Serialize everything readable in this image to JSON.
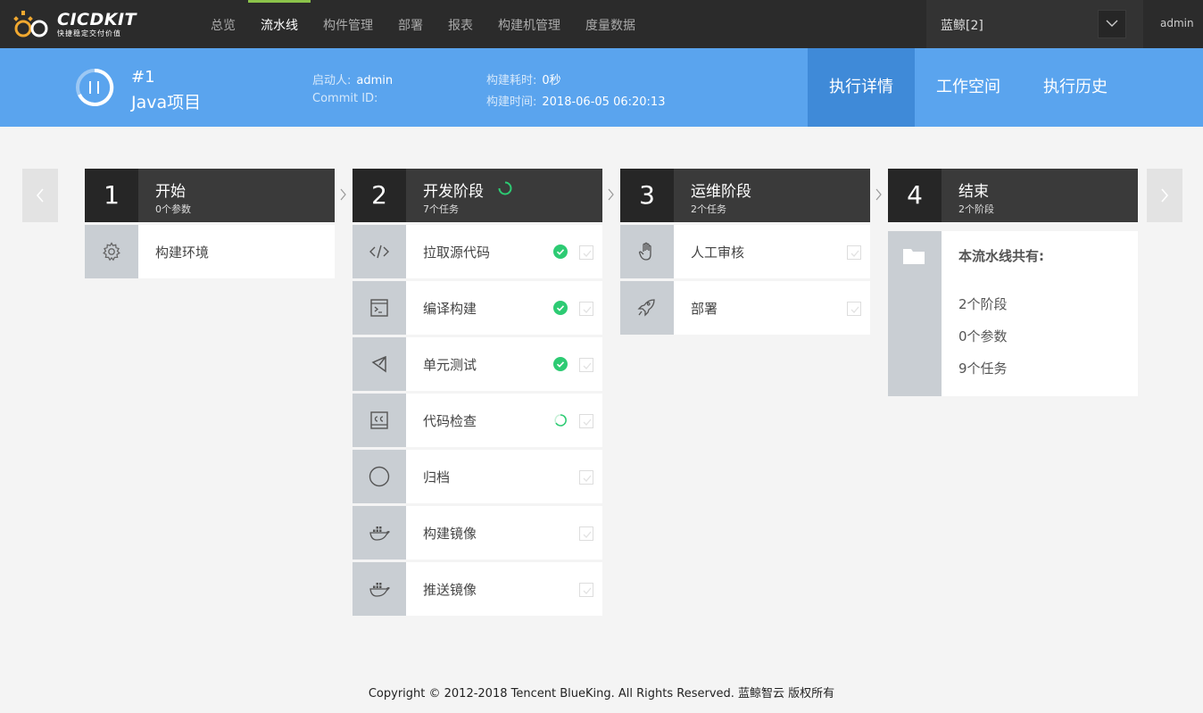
{
  "app": {
    "logo_text": "CICDKIT",
    "logo_sub": "快捷稳定交付价值"
  },
  "nav": {
    "items": [
      "总览",
      "流水线",
      "构件管理",
      "部署",
      "报表",
      "构建机管理",
      "度量数据"
    ],
    "active_index": 1
  },
  "business": {
    "label": "蓝鲸[2]"
  },
  "user": {
    "name": "admin"
  },
  "build": {
    "number": "#1",
    "name": "Java项目",
    "starter_label": "启动人:",
    "starter": "admin",
    "commit_label": "Commit ID:",
    "commit": "",
    "duration_label": "构建耗时:",
    "duration": "0秒",
    "time_label": "构建时间:",
    "time": "2018-06-05 06:20:13",
    "state": "paused"
  },
  "tabs": [
    "执行详情",
    "工作空间",
    "执行历史"
  ],
  "stages": [
    {
      "num": "1",
      "title": "开始",
      "sub": "0个参数",
      "running": false,
      "tasks": [
        {
          "name": "构建环境",
          "icon": "gear-icon",
          "status": "none"
        }
      ]
    },
    {
      "num": "2",
      "title": "开发阶段",
      "sub": "7个任务",
      "running": true,
      "tasks": [
        {
          "name": "拉取源代码",
          "icon": "code-icon",
          "status": "success"
        },
        {
          "name": "编译构建",
          "icon": "terminal-icon",
          "status": "success"
        },
        {
          "name": "单元测试",
          "icon": "unit-test-icon",
          "status": "success"
        },
        {
          "name": "代码检查",
          "icon": "code-check-icon",
          "status": "running"
        },
        {
          "name": "归档",
          "icon": "circle-icon",
          "status": "pending"
        },
        {
          "name": "构建镜像",
          "icon": "docker-icon",
          "status": "pending"
        },
        {
          "name": "推送镜像",
          "icon": "docker-icon",
          "status": "pending"
        }
      ]
    },
    {
      "num": "3",
      "title": "运维阶段",
      "sub": "2个任务",
      "running": false,
      "tasks": [
        {
          "name": "人工审核",
          "icon": "hand-icon",
          "status": "pending"
        },
        {
          "name": "部署",
          "icon": "rocket-icon",
          "status": "pending"
        }
      ]
    },
    {
      "num": "4",
      "title": "结束",
      "sub": "2个阶段",
      "running": false,
      "summary": {
        "title": "本流水线共有:",
        "lines": [
          "2个阶段",
          "0个参数",
          "9个任务"
        ]
      }
    }
  ],
  "colors": {
    "topbar": "#2b2b2b",
    "header": "#5aa4ee",
    "tab_active": "#3f8ad8",
    "nav_accent": "#8bc34a",
    "success": "#2dcb73"
  },
  "footer": {
    "text": "Copyright © 2012-2018 Tencent BlueKing. All Rights Reserved. 蓝鲸智云 版权所有"
  }
}
